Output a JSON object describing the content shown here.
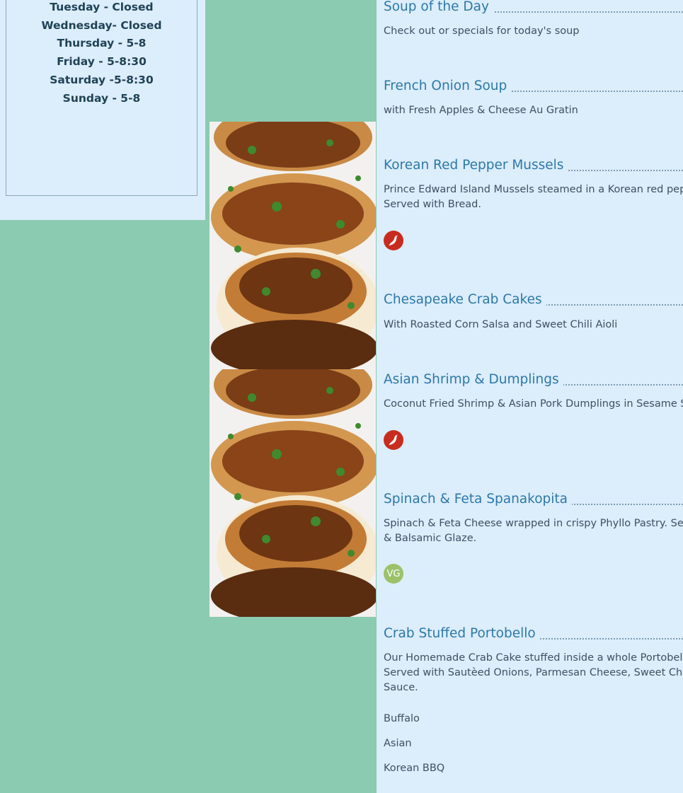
{
  "hours": [
    "Tuesday - Closed",
    "Wednesday-  Closed",
    "Thursday - 5-8",
    "Friday - 5-8:30",
    "Saturday -5-8:30",
    "Sunday - 5-8"
  ],
  "images": [
    "scallops-photo",
    "scallops-photo"
  ],
  "menu": {
    "items": [
      {
        "name": "Soup of the Day",
        "desc": [
          "Check out or specials for today's soup"
        ]
      },
      {
        "name": "French Onion Soup",
        "desc": [
          "with Fresh Apples & Cheese Au Gratin"
        ]
      },
      {
        "name": "Korean Red Pepper Mussels",
        "desc": [
          "Prince Edward Island Mussels steamed in a Korean red peppe",
          "Served with Bread."
        ],
        "badge": "chili-icon"
      },
      {
        "name": "Chesapeake Crab Cakes",
        "desc": [
          "With Roasted Corn Salsa and Sweet Chili Aioli"
        ]
      },
      {
        "name": "Asian Shrimp & Dumplings",
        "desc": [
          "Coconut Fried Shrimp & Asian Pork Dumplings in Sesame Soy"
        ],
        "badge": "chili-icon"
      },
      {
        "name": "Spinach & Feta Spanakopita",
        "desc": [
          "Spinach & Feta Cheese wrapped in crispy Phyllo Pastry. Serve",
          "& Balsamic Glaze."
        ],
        "badge": "VG"
      },
      {
        "name": "Crab Stuffed Portobello",
        "desc": [
          "Our Homemade Crab Cake stuffed inside a whole Portobello M",
          "Served with Sautèed Onions, Parmesan Cheese, Sweet Chili Ae",
          "Sauce."
        ]
      }
    ],
    "options": [
      "Buffalo",
      "Asian",
      "Korean BBQ"
    ]
  },
  "colors": {
    "background": "#8bcbb1",
    "panel": "#dcedfc",
    "title": "#2c79a8",
    "chili": "#c82c1f",
    "vegetarian": "#9bc26a"
  }
}
